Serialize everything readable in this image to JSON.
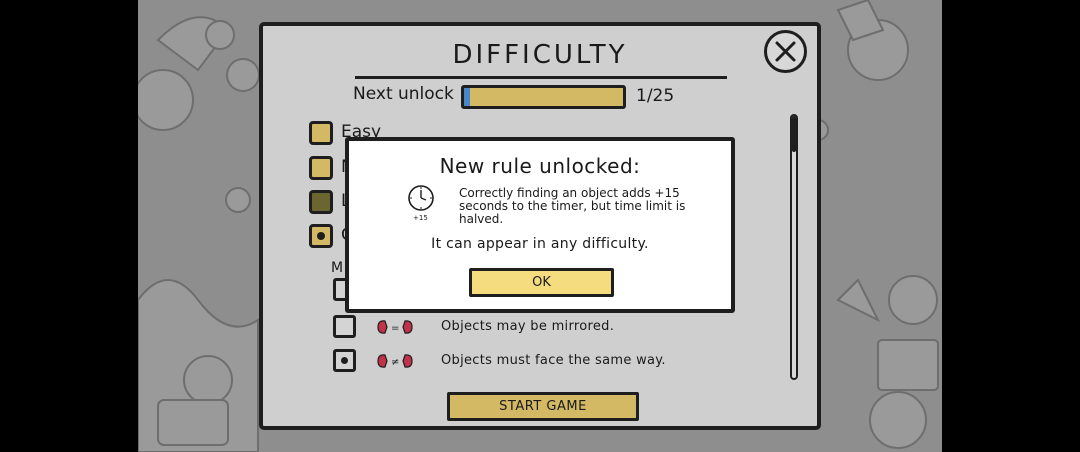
{
  "dialog": {
    "title": "DIFFICULTY",
    "next_unlock_label": "Next unlock",
    "next_unlock_progress": 0.04,
    "next_unlock_count": "1/25"
  },
  "difficulty_options": [
    {
      "label": "Easy",
      "state": "filled"
    },
    {
      "label": "N",
      "state": "filled"
    },
    {
      "label": "L",
      "state": "dark"
    },
    {
      "label": "C",
      "state": "selected"
    }
  ],
  "mode_label": "M",
  "rules": [
    {
      "text": "Objects may be mirrored.",
      "checked": false,
      "icon": "pieces-equal-icon"
    },
    {
      "text": "Objects must face the same way.",
      "checked": true,
      "icon": "pieces-not-equal-icon"
    }
  ],
  "start_button": "START GAME",
  "modal": {
    "title": "New rule unlocked:",
    "description": "Correctly finding an object adds +15 seconds to the timer, but time limit is halved.",
    "clock_label": "+15",
    "note": "It can appear in any difficulty.",
    "ok_label": "OK"
  },
  "colors": {
    "accent_gold": "#d4b964",
    "ok_yellow": "#f5dc7e",
    "progress_blue": "#4a86c8",
    "panel_gray": "#cfcfcf"
  }
}
